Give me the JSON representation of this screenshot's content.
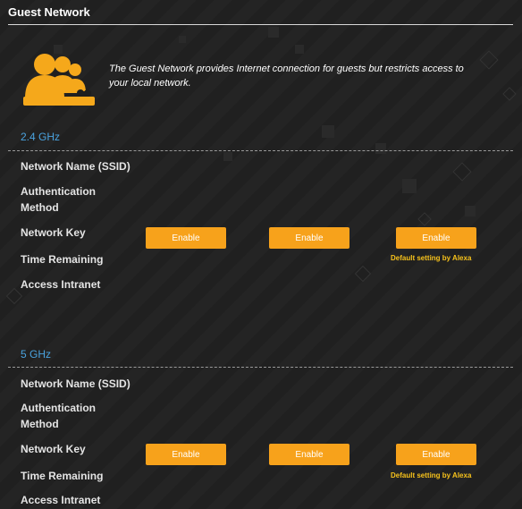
{
  "header": {
    "title": "Guest Network"
  },
  "intro": {
    "description": "The Guest Network provides Internet connection for guests but restricts access to your local network.",
    "icon": "guest-users-icon"
  },
  "bands": [
    {
      "label": "2.4 GHz",
      "rows": {
        "ssid": "Network Name (SSID)",
        "auth_line1": "Authentication",
        "auth_line2": "Method",
        "key": "Network Key",
        "time": "Time Remaining",
        "intranet": "Access Intranet"
      },
      "buttons": [
        "Enable",
        "Enable",
        "Enable"
      ],
      "alexa_note": "Default setting by Alexa"
    },
    {
      "label": "5 GHz",
      "rows": {
        "ssid": "Network Name (SSID)",
        "auth_line1": "Authentication",
        "auth_line2": "Method",
        "key": "Network Key",
        "time": "Time Remaining",
        "intranet": "Access Intranet"
      },
      "buttons": [
        "Enable",
        "Enable",
        "Enable"
      ],
      "alexa_note": "Default setting by Alexa"
    }
  ],
  "colors": {
    "accent_orange": "#f7a21b",
    "band_label_blue": "#4aa3df",
    "alexa_note_yellow": "#f7c21b",
    "background": "#202020"
  }
}
